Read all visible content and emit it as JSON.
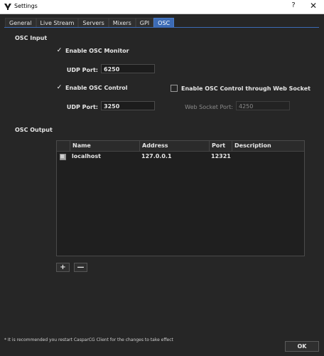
{
  "window": {
    "title": "Settings",
    "help_glyph": "?",
    "close_glyph": "✕"
  },
  "tabs": [
    {
      "label": "General",
      "active": false
    },
    {
      "label": "Live Stream",
      "active": false
    },
    {
      "label": "Servers",
      "active": false
    },
    {
      "label": "Mixers",
      "active": false
    },
    {
      "label": "GPI",
      "active": false
    },
    {
      "label": "OSC",
      "active": true
    }
  ],
  "osc_input": {
    "section_label": "OSC Input",
    "enable_monitor": {
      "label": "Enable OSC Monitor",
      "checked": true
    },
    "monitor_udp_port": {
      "label": "UDP Port:",
      "value": "6250"
    },
    "enable_control": {
      "label": "Enable OSC Control",
      "checked": true
    },
    "control_udp_port": {
      "label": "UDP Port:",
      "value": "3250"
    },
    "enable_websocket": {
      "label": "Enable OSC Control through Web Socket",
      "checked": false
    },
    "websocket_port": {
      "label": "Web Socket Port:",
      "value": "4250",
      "enabled": false
    }
  },
  "osc_output": {
    "section_label": "OSC Output",
    "columns": [
      "Name",
      "Address",
      "Port",
      "Description"
    ],
    "rows": [
      {
        "name": "localhost",
        "address": "127.0.0.1",
        "port": "12321",
        "description": ""
      }
    ],
    "add_label": "+",
    "remove_label": "—"
  },
  "footnote": "* It is recommended you restart CasparCG Client for the changes to take effect",
  "ok_label": "OK",
  "colors": {
    "background": "#262626",
    "accent": "#3c6bb5",
    "text": "#e6e6e6"
  }
}
